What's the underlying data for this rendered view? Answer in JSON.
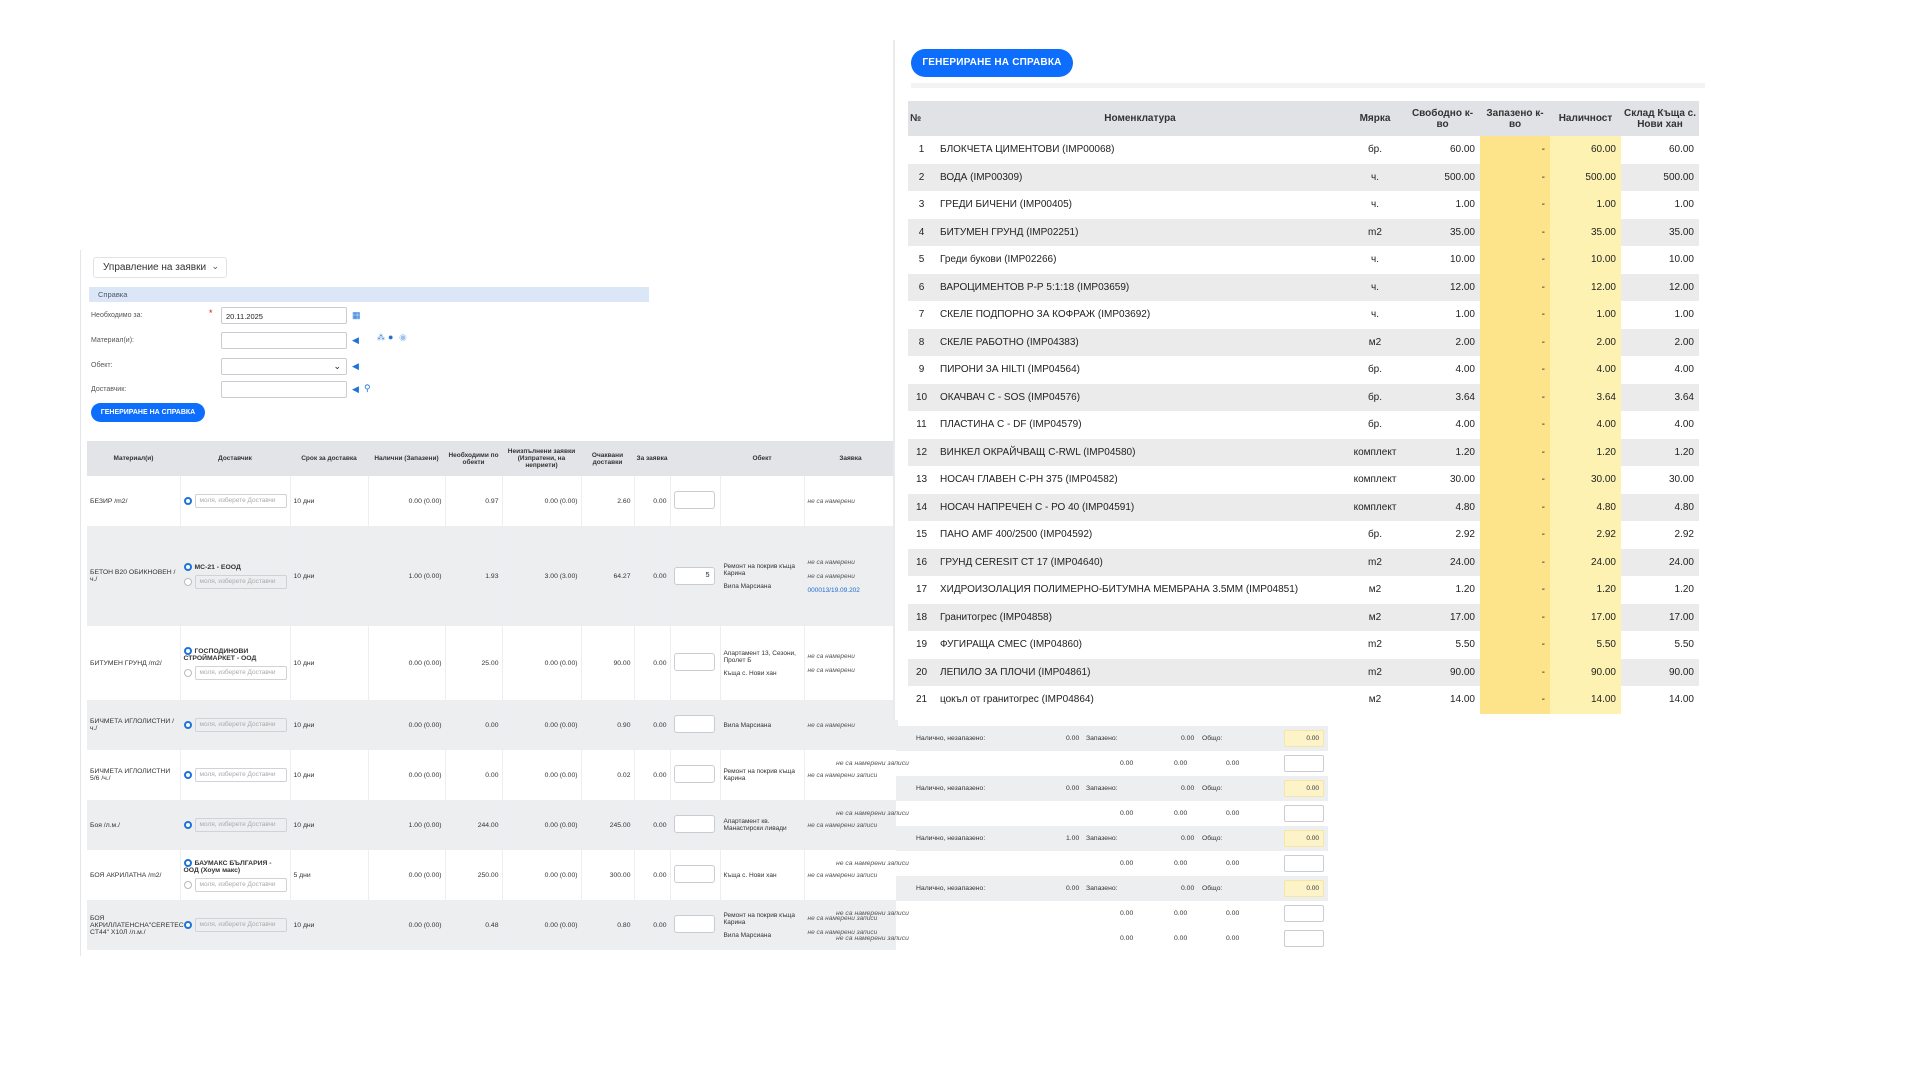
{
  "form": {
    "module_select": "Управление на заявки",
    "section_title": "Справка",
    "date_label": "Необходимо за:",
    "date_value": "20.11.2025",
    "material_label": "Материал(и):",
    "object_label": "Обект:",
    "supplier_label": "Доставчик:",
    "generate_button": "ГЕНЕРИРАНЕ НА СПРАВКА"
  },
  "left_table": {
    "headers": [
      "Материал(и)",
      "Доставчик",
      "Срок за доставка",
      "Налични (Запазени)",
      "Необходими по обекти",
      "Неизпълнени заявки (Изпратени, на неприети)",
      "Очаквани доставки",
      "За заявка",
      "Обект",
      "Заявка"
    ],
    "supplier_placeholder": "моля, изберете Доставчи",
    "no_records": "не са намерени",
    "rows": [
      {
        "material": "БЕЗИР /m2/",
        "supplier": "",
        "term": "10 дни",
        "available": "0.00 (0.00)",
        "needed": "0.97",
        "open": "0.00 (0.00)",
        "expected": "2.60",
        "order": "0.00",
        "qty": "",
        "objects": [
          "",
          ""
        ],
        "requests": [
          "не са намерени"
        ]
      },
      {
        "material": "БЕТОН В20 ОБИКНОВЕН / ч./",
        "supplier": "МС-21 - ЕООД",
        "term": "10 дни",
        "available": "1.00 (0.00)",
        "needed": "1.93",
        "open": "3.00 (3.00)",
        "expected": "64.27",
        "order": "0.00",
        "qty": "5",
        "objects": [
          "Ремонт на покрив къща Карина",
          "Вила Марсиана"
        ],
        "requests": [
          "не са намерени",
          "не са намерени",
          "000013/19.09.202"
        ]
      },
      {
        "material": "БИТУМЕН ГРУНД /m2/",
        "supplier": "ГОСПОДИНОВИ СТРОЙМАРКЕТ - ООД",
        "term": "10 дни",
        "available": "0.00 (0.00)",
        "needed": "25.00",
        "open": "0.00 (0.00)",
        "expected": "90.00",
        "order": "0.00",
        "qty": "",
        "objects": [
          "Апартамент 13, Сезони, Пролет Б",
          "Къща с. Нови хан"
        ],
        "requests": [
          "не са намерени",
          "не са намерени"
        ]
      },
      {
        "material": "БИЧМЕТА ИГЛОЛИСТНИ / ч./",
        "supplier": "",
        "term": "10 дни",
        "available": "0.00 (0.00)",
        "needed": "0.00",
        "open": "0.00 (0.00)",
        "expected": "0.90",
        "order": "0.00",
        "qty": "",
        "objects": [
          "Вила Марсиана"
        ],
        "requests": [
          "не са намерени"
        ]
      },
      {
        "material": "БИЧМЕТА ИГЛОЛИСТНИ 5/6 /ч./",
        "supplier": "",
        "term": "10 дни",
        "available": "0.00 (0.00)",
        "needed": "0.00",
        "open": "0.00 (0.00)",
        "expected": "0.02",
        "order": "0.00",
        "qty": "",
        "objects": [
          "Ремонт на покрив къща Карина"
        ],
        "requests": [
          "не са намерени записи"
        ]
      },
      {
        "material": "Боя /л.м./",
        "supplier": "",
        "term": "10 дни",
        "available": "1.00 (0.00)",
        "needed": "244.00",
        "open": "0.00 (0.00)",
        "expected": "245.00",
        "order": "0.00",
        "qty": "",
        "objects": [
          "Апартамент кв. Манастирски ливади"
        ],
        "requests": [
          "не са намерени записи"
        ]
      },
      {
        "material": "БОЯ АКРИЛАТНА /m2/",
        "supplier": "БАУМАКС БЪЛГАРИЯ - ООД (Хоум макс)",
        "term": "5 дни",
        "available": "0.00 (0.00)",
        "needed": "250.00",
        "open": "0.00 (0.00)",
        "expected": "300.00",
        "order": "0.00",
        "qty": "",
        "objects": [
          "Къща с. Нови хан"
        ],
        "requests": [
          "не са намерени записи"
        ]
      },
      {
        "material": "БОЯ АКРИЛЛАТЕНСНА\"CERETEC CT44\" Х10Л /л.м./",
        "supplier": "",
        "term": "10 дни",
        "available": "0.00 (0.00)",
        "needed": "0.48",
        "open": "0.00 (0.00)",
        "expected": "0.80",
        "order": "0.00",
        "qty": "",
        "objects": [
          "Ремонт на покрив къща Карина",
          "Вила Марсиана"
        ],
        "requests": [
          "не са намерени записи",
          "не са намерени записи"
        ]
      }
    ]
  },
  "extension": {
    "avail_label": "Налично, незапазено:",
    "reserved_label": "Запазено:",
    "total_label": "Общо:",
    "summary_rows": [
      {
        "avail": "0.00",
        "reserved": "0.00",
        "total": "0.00"
      },
      {
        "avail": "0.00",
        "reserved": "0.00",
        "total": "0.00"
      },
      {
        "avail": "1.00",
        "reserved": "0.00",
        "total": "0.00"
      },
      {
        "avail": "0.00",
        "reserved": "0.00",
        "total": "0.00"
      }
    ],
    "detail_rows": [
      {
        "note": "не са намерени записи",
        "a": "0.00",
        "b": "0.00",
        "c": "0.00"
      },
      {
        "note": "не са намерени записи",
        "a": "0.00",
        "b": "0.00",
        "c": "0.00"
      },
      {
        "note": "не са намерени записи",
        "a": "0.00",
        "b": "0.00",
        "c": "0.00"
      },
      {
        "note": "не са намерени записи",
        "a": "0.00",
        "b": "0.00",
        "c": "0.00"
      },
      {
        "note": "не са намерени записи",
        "a": "0.00",
        "b": "0.00",
        "c": "0.00"
      }
    ]
  },
  "report": {
    "generate_button": "ГЕНЕРИРАНЕ НА СПРАВКА",
    "headers": [
      "№",
      "Номенклатура",
      "Мярка",
      "Свободно к-во",
      "Запазено к-во",
      "Наличност",
      "Склад Къща с. Нови хан"
    ],
    "rows": [
      [
        "1",
        "БЛОКЧЕТА ЦИМЕНТОВИ (IMP00068)",
        "бр.",
        "60.00",
        "-",
        "60.00",
        "60.00"
      ],
      [
        "2",
        "ВОДА (IMP00309)",
        "ч.",
        "500.00",
        "-",
        "500.00",
        "500.00"
      ],
      [
        "3",
        "ГРЕДИ БИЧЕНИ (IMP00405)",
        "ч.",
        "1.00",
        "-",
        "1.00",
        "1.00"
      ],
      [
        "4",
        "БИТУМЕН ГРУНД (IMP02251)",
        "m2",
        "35.00",
        "-",
        "35.00",
        "35.00"
      ],
      [
        "5",
        "Греди букови (IMP02266)",
        "ч.",
        "10.00",
        "-",
        "10.00",
        "10.00"
      ],
      [
        "6",
        "ВАРОЦИМЕНТОВ Р-Р 5:1:18 (IMP03659)",
        "ч.",
        "12.00",
        "-",
        "12.00",
        "12.00"
      ],
      [
        "7",
        "СКЕЛЕ ПОДПОРНО ЗА КОФРАЖ (IMP03692)",
        "ч.",
        "1.00",
        "-",
        "1.00",
        "1.00"
      ],
      [
        "8",
        "СКЕЛЕ РАБОТНО (IMP04383)",
        "м2",
        "2.00",
        "-",
        "2.00",
        "2.00"
      ],
      [
        "9",
        "ПИРОНИ ЗА HILTI (IMP04564)",
        "бр.",
        "4.00",
        "-",
        "4.00",
        "4.00"
      ],
      [
        "10",
        "ОКАЧВАЧ С - SOS (IMP04576)",
        "бр.",
        "3.64",
        "-",
        "3.64",
        "3.64"
      ],
      [
        "11",
        "ПЛАСТИНА С - DF (IMP04579)",
        "бр.",
        "4.00",
        "-",
        "4.00",
        "4.00"
      ],
      [
        "12",
        "ВИНКЕЛ ОКРАЙЧВАЩ C-RWL (IMP04580)",
        "комплект",
        "1.20",
        "-",
        "1.20",
        "1.20"
      ],
      [
        "13",
        "НОСАЧ ГЛАВЕН С-РН 375 (IMP04582)",
        "комплект",
        "30.00",
        "-",
        "30.00",
        "30.00"
      ],
      [
        "14",
        "НОСАЧ НАПРЕЧЕН С - РО 40 (IMP04591)",
        "комплект",
        "4.80",
        "-",
        "4.80",
        "4.80"
      ],
      [
        "15",
        "ПАНО AMF 400/2500 (IMP04592)",
        "бр.",
        "2.92",
        "-",
        "2.92",
        "2.92"
      ],
      [
        "16",
        "ГРУНД CERESIT СТ 17 (IMP04640)",
        "m2",
        "24.00",
        "-",
        "24.00",
        "24.00"
      ],
      [
        "17",
        "ХИДРОИЗОЛАЦИЯ ПОЛИМЕРНО-БИТУМНА МЕМБРАНА 3.5ММ (IMP04851)",
        "м2",
        "1.20",
        "-",
        "1.20",
        "1.20"
      ],
      [
        "18",
        "Гранитогрес (IMP04858)",
        "м2",
        "17.00",
        "-",
        "17.00",
        "17.00"
      ],
      [
        "19",
        "ФУГИРАЩА СМЕС (IMP04860)",
        "m2",
        "5.50",
        "-",
        "5.50",
        "5.50"
      ],
      [
        "20",
        "ЛЕПИЛО ЗА ПЛОЧИ (IMP04861)",
        "m2",
        "90.00",
        "-",
        "90.00",
        "90.00"
      ],
      [
        "21",
        "цокъл от гранитогрес (IMP04864)",
        "м2",
        "14.00",
        "-",
        "14.00",
        "14.00"
      ]
    ]
  },
  "colors": {
    "accent": "#0d6efd",
    "reserved_col": "#fde38a",
    "stock_col": "#fdf2b2"
  }
}
